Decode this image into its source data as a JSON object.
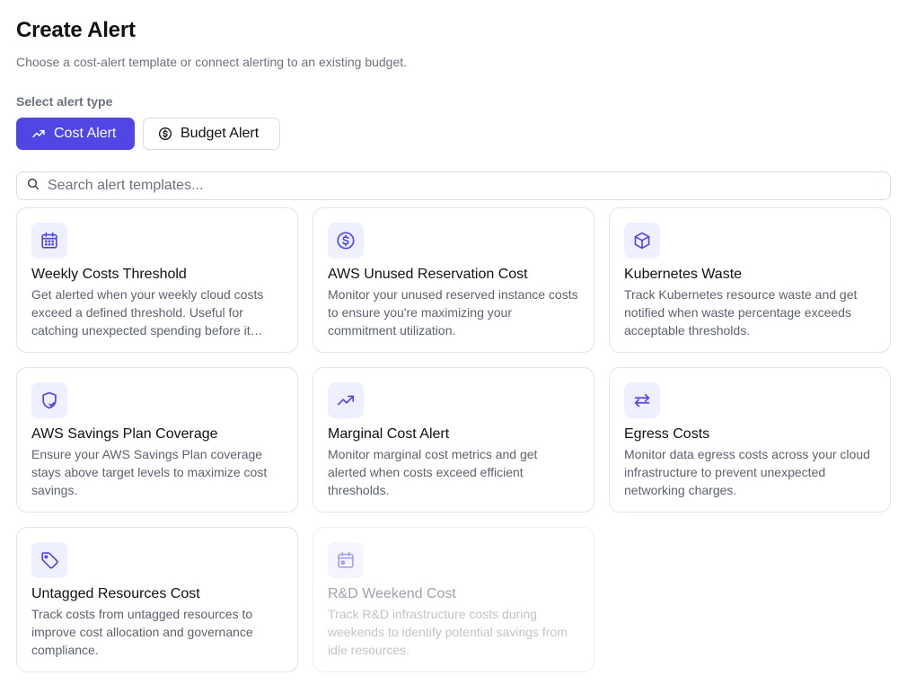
{
  "header": {
    "title": "Create Alert",
    "subtitle": "Choose a cost-alert template or connect alerting to an existing budget."
  },
  "alert_type": {
    "label": "Select alert type",
    "options": [
      {
        "label": "Cost Alert",
        "icon": "trending-up-icon",
        "selected": true
      },
      {
        "label": "Budget Alert",
        "icon": "dollar-circle-icon",
        "selected": false
      }
    ]
  },
  "search": {
    "placeholder": "Search alert templates...",
    "value": ""
  },
  "accent_color": "#4f46e5",
  "templates": [
    {
      "title": "Weekly Costs Threshold",
      "description": "Get alerted when your weekly cloud costs exceed a defined threshold. Useful for catching unexpected spending before it becomes a problem.",
      "icon": "calendar-icon",
      "enabled": true
    },
    {
      "title": "AWS Unused Reservation Cost",
      "description": "Monitor your unused reserved instance costs to ensure you're maximizing your commitment utilization.",
      "icon": "dollar-circle-icon",
      "enabled": true
    },
    {
      "title": "Kubernetes Waste",
      "description": "Track Kubernetes resource waste and get notified when waste percentage exceeds acceptable thresholds.",
      "icon": "cube-icon",
      "enabled": true
    },
    {
      "title": "AWS Savings Plan Coverage",
      "description": "Ensure your AWS Savings Plan coverage stays above target levels to maximize cost savings.",
      "icon": "shield-check-icon",
      "enabled": true
    },
    {
      "title": "Marginal Cost Alert",
      "description": "Monitor marginal cost metrics and get alerted when costs exceed efficient thresholds.",
      "icon": "trending-up-icon",
      "enabled": true
    },
    {
      "title": "Egress Costs",
      "description": "Monitor data egress costs across your cloud infrastructure to prevent unexpected networking charges.",
      "icon": "arrows-exchange-icon",
      "enabled": true
    },
    {
      "title": "Untagged Resources Cost",
      "description": "Track costs from untagged resources to improve cost allocation and governance compliance.",
      "icon": "tag-icon",
      "enabled": true
    },
    {
      "title": "R&D Weekend Cost",
      "description": "Track R&D infrastructure costs during weekends to identify potential savings from idle resources.",
      "icon": "calendar-dot-icon",
      "enabled": false
    }
  ]
}
